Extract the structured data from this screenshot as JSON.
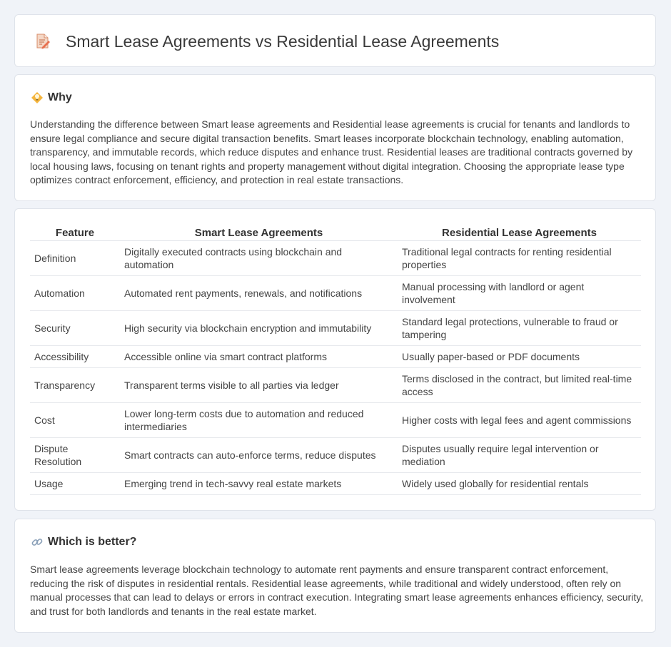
{
  "header": {
    "title": "Smart Lease Agreements vs Residential Lease Agreements",
    "icon": "document-edit-icon"
  },
  "why": {
    "heading": "Why",
    "icon": "lightbulb-icon",
    "text": "Understanding the difference between Smart lease agreements and Residential lease agreements is crucial for tenants and landlords to ensure legal compliance and secure digital transaction benefits. Smart leases incorporate blockchain technology, enabling automation, transparency, and immutable records, which reduce disputes and enhance trust. Residential leases are traditional contracts governed by local housing laws, focusing on tenant rights and property management without digital integration. Choosing the appropriate lease type optimizes contract enforcement, efficiency, and protection in real estate transactions."
  },
  "table": {
    "headers": [
      "Feature",
      "Smart Lease Agreements",
      "Residential Lease Agreements"
    ],
    "rows": [
      {
        "feature": "Definition",
        "smart": "Digitally executed contracts using blockchain and automation",
        "residential": "Traditional legal contracts for renting residential properties"
      },
      {
        "feature": "Automation",
        "smart": "Automated rent payments, renewals, and notifications",
        "residential": "Manual processing with landlord or agent involvement"
      },
      {
        "feature": "Security",
        "smart": "High security via blockchain encryption and immutability",
        "residential": "Standard legal protections, vulnerable to fraud or tampering"
      },
      {
        "feature": "Accessibility",
        "smart": "Accessible online via smart contract platforms",
        "residential": "Usually paper-based or PDF documents"
      },
      {
        "feature": "Transparency",
        "smart": "Transparent terms visible to all parties via ledger",
        "residential": "Terms disclosed in the contract, but limited real-time access"
      },
      {
        "feature": "Cost",
        "smart": "Lower long-term costs due to automation and reduced intermediaries",
        "residential": "Higher costs with legal fees and agent commissions"
      },
      {
        "feature": "Dispute Resolution",
        "smart": "Smart contracts can auto-enforce terms, reduce disputes",
        "residential": "Disputes usually require legal intervention or mediation"
      },
      {
        "feature": "Usage",
        "smart": "Emerging trend in tech-savvy real estate markets",
        "residential": "Widely used globally for residential rentals"
      }
    ]
  },
  "better": {
    "heading": "Which is better?",
    "icon": "link-icon",
    "text": "Smart lease agreements leverage blockchain technology to automate rent payments and ensure transparent contract enforcement, reducing the risk of disputes in residential rentals. Residential lease agreements, while traditional and widely understood, often rely on manual processes that can lead to delays or errors in contract execution. Integrating smart lease agreements enhances efficiency, security, and trust for both landlords and tenants in the real estate market."
  }
}
